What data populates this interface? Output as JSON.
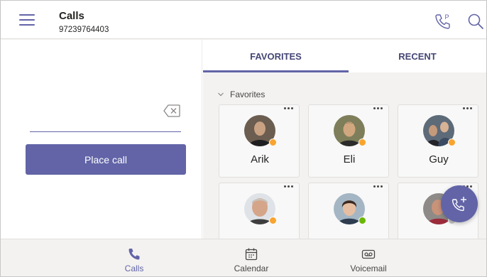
{
  "header": {
    "title": "Calls",
    "number": "97239764403",
    "phone_icon": "phone-p-icon",
    "search_icon": "search-icon"
  },
  "dialer": {
    "input_value": "",
    "backspace_icon": "backspace-icon",
    "place_call_label": "Place call"
  },
  "tabs": [
    {
      "label": "FAVORITES",
      "active": true
    },
    {
      "label": "RECENT",
      "active": false
    }
  ],
  "favorites": {
    "group_label": "Favorites",
    "contacts": [
      {
        "name": "Arik",
        "presence": "away"
      },
      {
        "name": "Eli",
        "presence": "away"
      },
      {
        "name": "Guy",
        "presence": "away"
      },
      {
        "name": "",
        "presence": "away"
      },
      {
        "name": "",
        "presence": "available"
      },
      {
        "name": "",
        "presence": "offline"
      }
    ]
  },
  "fab": {
    "icon": "add-call-icon"
  },
  "bottom_nav": [
    {
      "label": "Calls",
      "icon": "phone-icon",
      "active": true
    },
    {
      "label": "Calendar",
      "icon": "calendar-icon",
      "active": false
    },
    {
      "label": "Voicemail",
      "icon": "voicemail-icon",
      "active": false
    }
  ],
  "colors": {
    "accent": "#6264a7",
    "away": "#f8a42f",
    "available": "#6bb700",
    "offline": "#c8c6c4"
  }
}
